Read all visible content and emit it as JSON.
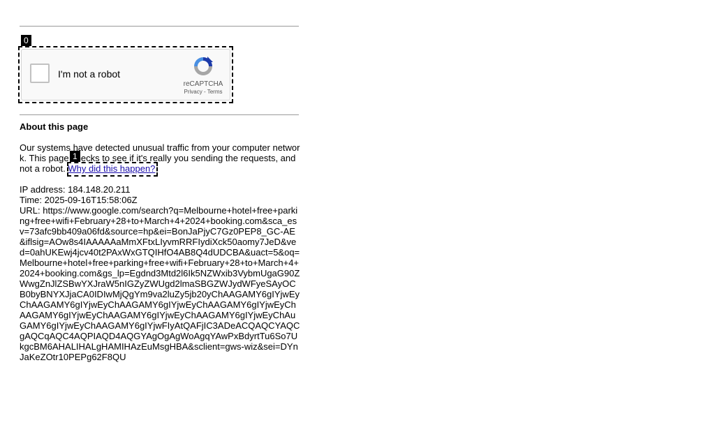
{
  "markers": {
    "captcha": "0",
    "link": "1"
  },
  "captcha": {
    "label": "I'm not a robot",
    "brand": "reCAPTCHA",
    "privacy": "Privacy",
    "sep": " - ",
    "terms": "Terms"
  },
  "about": {
    "heading": "About this page",
    "text": "Our systems have detected unusual traffic from your computer network. This page checks to see if it's really you sending the requests, and not a robot. ",
    "link": "Why did this happen?"
  },
  "info": {
    "ip": "IP address: 184.148.20.211",
    "time": "Time: 2025-09-16T15:58:06Z",
    "url": "URL: https://www.google.com/search?q=Melbourne+hotel+free+parking+free+wifi+February+28+to+March+4+2024+booking.com&sca_esv=73afc9bb409a06fd&source=hp&ei=BonJaPjyC7Gz0PEP8_GC-AE&iflsig=AOw8s4IAAAAAaMmXFtxLIyvmRRFIydiXck50aomy7JeD&ved=0ahUKEwj4jcv40t2PAxWxGTQIHfO4AB8Q4dUDCBA&uact=5&oq=Melbourne+hotel+free+parking+free+wifi+February+28+to+March+4+2024+booking.com&gs_lp=Egdnd3Mtd2l6Ik5NZWxib3VybmUgaG90ZWwgZnJlZSBwYXJraW5nIGZyZWUgd2lmaSBGZWJydWFyeSAyOCB0byBNYXJjaCA0IDIwMjQgYm9va2luZy5jb20yChAAGAMY6gIYjwEyChAAGAMY6gIYjwEyChAAGAMY6gIYjwEyChAAGAMY6gIYjwEyChAAGAMY6gIYjwEyChAAGAMY6gIYjwEyChAAGAMY6gIYjwEyChAuGAMY6gIYjwEyChAAGAMY6gIYjwFIyAtQAFjIC3ADeACQAQCYAQCgAQCqAQC4AQPIAQD4AQGYAgOgAgWoAgqYAwPxBdyrtTu6So7UkgcBM6AHALIHALgHAMIHAzEuMsgHBA&sclient=gws-wiz&sei=DYnJaKeZOtr10PEPg62F8QU"
  }
}
